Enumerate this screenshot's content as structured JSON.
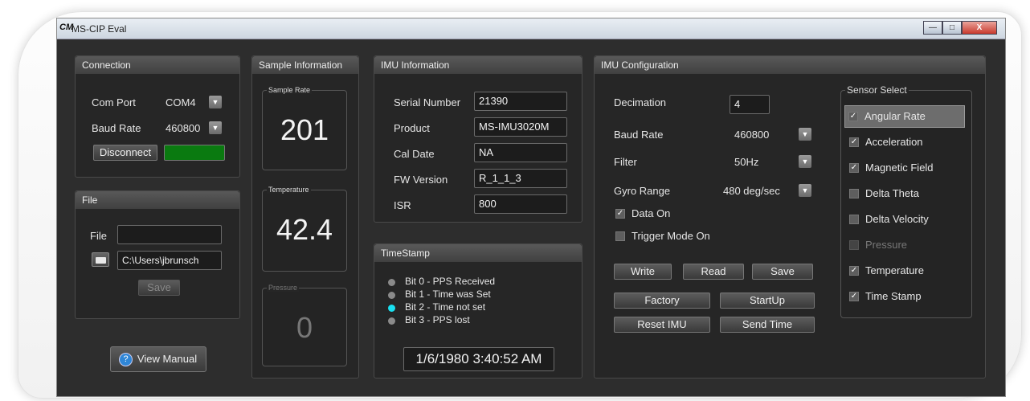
{
  "window": {
    "title": "MS-CIP Eval",
    "logo": "CM",
    "minimize": "—",
    "maximize": "□",
    "close": "X"
  },
  "connection": {
    "header": "Connection",
    "com_port_label": "Com Port",
    "com_port_value": "COM4",
    "baud_label": "Baud Rate",
    "baud_value": "460800",
    "disconnect_label": "Disconnect",
    "status_color": "#0a7a10"
  },
  "file": {
    "header": "File",
    "file_label": "File",
    "file_value": "",
    "path_value": "C:\\Users\\jbrunsch",
    "save_label": "Save"
  },
  "view_manual_label": "View Manual",
  "sample": {
    "header": "Sample Information",
    "rate_label": "Sample Rate",
    "rate_value": "201",
    "temp_label": "Temperature",
    "temp_value": "42.4",
    "pressure_label": "Pressure",
    "pressure_value": "0"
  },
  "imu_info": {
    "header": "IMU Information",
    "serial_label": "Serial Number",
    "serial_value": "21390",
    "product_label": "Product",
    "product_value": "MS-IMU3020M",
    "cal_label": "Cal Date",
    "cal_value": "NA",
    "fw_label": "FW Version",
    "fw_value": "R_1_1_3",
    "isr_label": "ISR",
    "isr_value": "800"
  },
  "timestamp": {
    "header": "TimeStamp",
    "bits": [
      {
        "label": "Bit 0 - PPS Received",
        "color": "#8a8a8a"
      },
      {
        "label": "Bit 1 - Time was Set",
        "color": "#8a8a8a"
      },
      {
        "label": "Bit 2 - Time not set",
        "color": "#19e0f0"
      },
      {
        "label": "Bit 3 - PPS lost",
        "color": "#8a8a8a"
      }
    ],
    "datetime": "1/6/1980 3:40:52 AM"
  },
  "imu_config": {
    "header": "IMU Configuration",
    "decimation_label": "Decimation",
    "decimation_value": "4",
    "baud_label": "Baud Rate",
    "baud_value": "460800",
    "filter_label": "Filter",
    "filter_value": "50Hz",
    "gyro_label": "Gyro Range",
    "gyro_value": "480 deg/sec",
    "data_on_label": "Data On",
    "data_on": true,
    "trigger_label": "Trigger Mode On",
    "trigger_on": false,
    "write_label": "Write",
    "read_label": "Read",
    "save_label": "Save",
    "factory_label": "Factory",
    "startup_label": "StartUp",
    "reset_label": "Reset IMU",
    "send_time_label": "Send Time"
  },
  "sensor_select": {
    "header": "Sensor Select",
    "items": [
      {
        "label": "Angular Rate",
        "checked": true
      },
      {
        "label": "Acceleration",
        "checked": true
      },
      {
        "label": "Magnetic Field",
        "checked": true
      },
      {
        "label": "Delta Theta",
        "checked": false
      },
      {
        "label": "Delta Velocity",
        "checked": false
      },
      {
        "label": "Pressure",
        "checked": false
      },
      {
        "label": "Temperature",
        "checked": true
      },
      {
        "label": "Time Stamp",
        "checked": true
      }
    ]
  }
}
